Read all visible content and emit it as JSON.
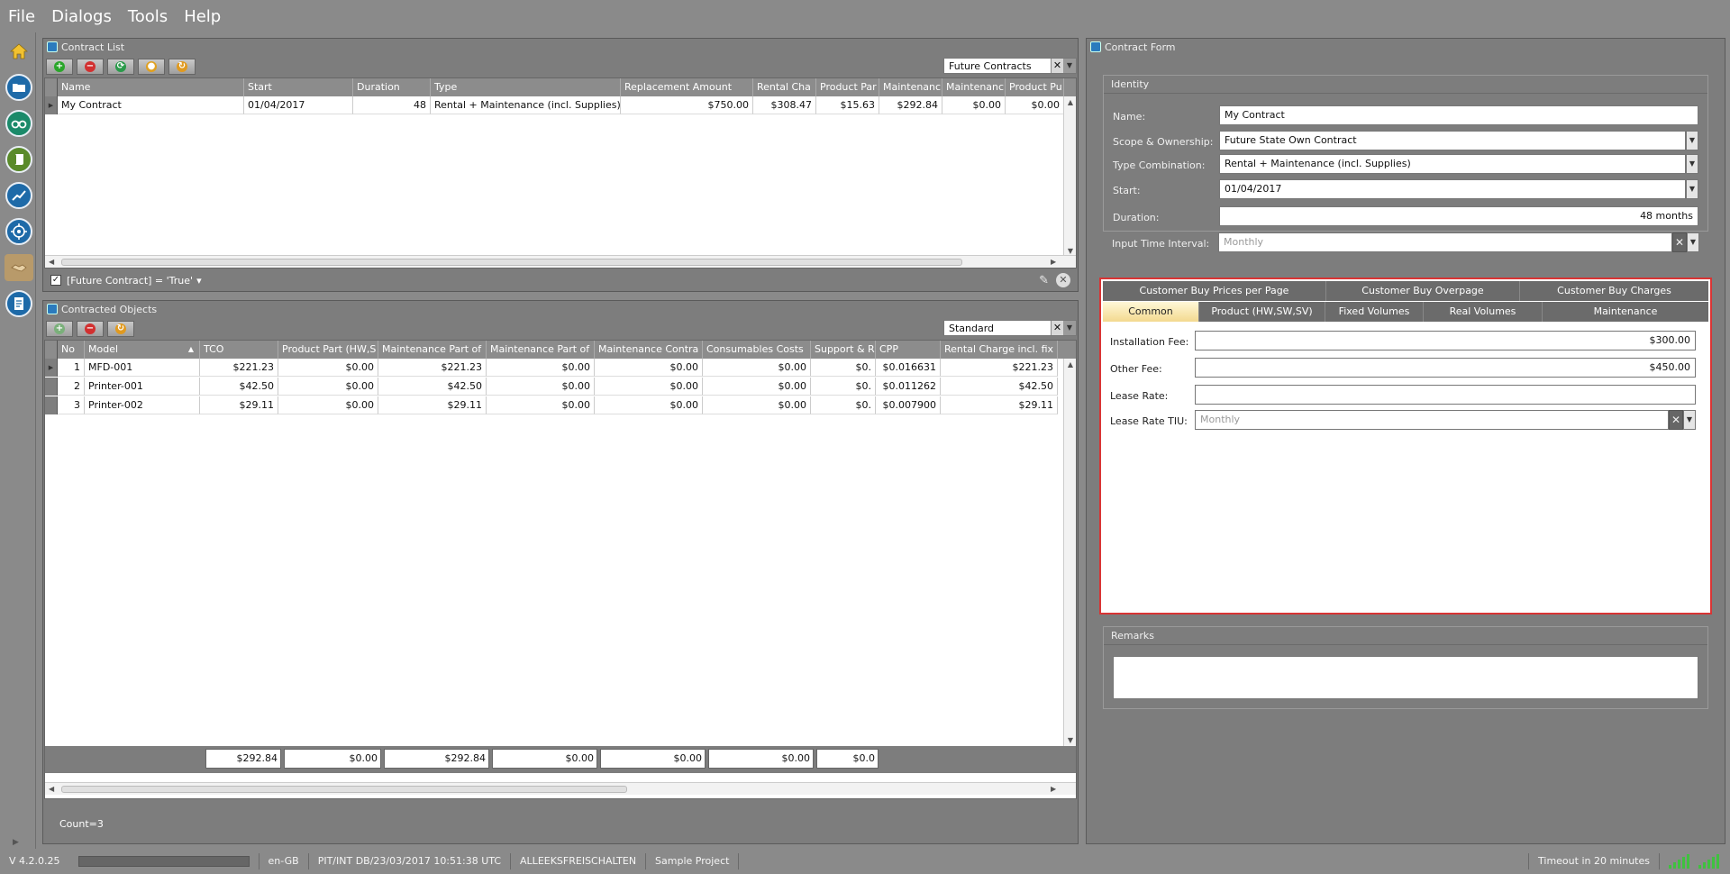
{
  "menu": {
    "items": [
      "File",
      "Dialogs",
      "Tools",
      "Help"
    ]
  },
  "rail": {
    "icons": [
      "home-icon",
      "folder-icon",
      "binoculars-icon",
      "scroll-icon",
      "trend-icon",
      "target-icon",
      "handshake-icon",
      "report-icon"
    ]
  },
  "contract_list": {
    "title": "Contract List",
    "view_selector": "Future Contracts",
    "columns": [
      "Name",
      "Start",
      "Duration",
      "Type",
      "Replacement Amount",
      "Rental Cha",
      "Product Par",
      "Maintenanc",
      "Maintenanc",
      "Product Pu"
    ],
    "rows": [
      [
        "My Contract",
        "01/04/2017",
        "48",
        "Rental + Maintenance (incl. Supplies)",
        "$750.00",
        "$308.47",
        "$15.63",
        "$292.84",
        "$0.00",
        "$0.00"
      ]
    ],
    "filter_text": "[Future Contract] = 'True'",
    "filter_dropdown": "▾"
  },
  "contracted_objects": {
    "title": "Contracted Objects",
    "view_selector": "Standard",
    "columns": [
      "No",
      "Model",
      "TCO",
      "Product Part (HW,S",
      "Maintenance Part of",
      "Maintenance Part of",
      "Maintenance Contra",
      "Consumables Costs",
      "Support & R",
      "CPP",
      "Rental Charge incl. fix"
    ],
    "sort_indicator": "▲",
    "rows": [
      [
        "1",
        "MFD-001",
        "$221.23",
        "$0.00",
        "$221.23",
        "$0.00",
        "$0.00",
        "$0.00",
        "$0.",
        "$0.016631",
        "$221.23"
      ],
      [
        "2",
        "Printer-001",
        "$42.50",
        "$0.00",
        "$42.50",
        "$0.00",
        "$0.00",
        "$0.00",
        "$0.",
        "$0.011262",
        "$42.50"
      ],
      [
        "3",
        "Printer-002",
        "$29.11",
        "$0.00",
        "$29.11",
        "$0.00",
        "$0.00",
        "$0.00",
        "$0.",
        "$0.007900",
        "$29.11"
      ]
    ],
    "totals": [
      "$292.84",
      "$0.00",
      "$292.84",
      "$0.00",
      "$0.00",
      "$0.00",
      "$0.0"
    ],
    "count_label": "Count=3"
  },
  "contract_form": {
    "title": "Contract Form",
    "identity": {
      "header": "Identity",
      "name_label": "Name:",
      "name_value": "My Contract",
      "scope_label": "Scope & Ownership:",
      "scope_value": "Future State Own Contract",
      "type_label": "Type Combination:",
      "type_value": "Rental + Maintenance (incl. Supplies)",
      "start_label": "Start:",
      "start_value": "01/04/2017",
      "duration_label": "Duration:",
      "duration_value": "48 months",
      "interval_label": "Input Time Interval:",
      "interval_placeholder": "Monthly"
    },
    "tabs_row1": [
      "Customer Buy Prices per Page",
      "Customer Buy Overpage",
      "Customer Buy Charges"
    ],
    "tabs_row2": [
      "Common",
      "Product (HW,SW,SV)",
      "Fixed Volumes",
      "Real Volumes",
      "Maintenance"
    ],
    "active_tab": "Common",
    "common": {
      "install_label": "Installation Fee:",
      "install_value": "$300.00",
      "other_label": "Other Fee:",
      "other_value": "$450.00",
      "lease_label": "Lease Rate:",
      "lease_value": "",
      "lease_tiu_label": "Lease Rate TIU:",
      "lease_tiu_placeholder": "Monthly"
    },
    "remarks": {
      "header": "Remarks",
      "value": ""
    }
  },
  "status": {
    "version": "V 4.2.0.25",
    "locale": "en-GB",
    "db": "PIT/INT DB/23/03/2017 10:51:38 UTC",
    "user": "ALLEEKSFREISCHALTEN",
    "project": "Sample Project",
    "timeout": "Timeout in 20 minutes"
  },
  "colors": {
    "highlight_border": "#d93434",
    "active_tab": "#f3d98f",
    "signal": "#3fc13f"
  }
}
